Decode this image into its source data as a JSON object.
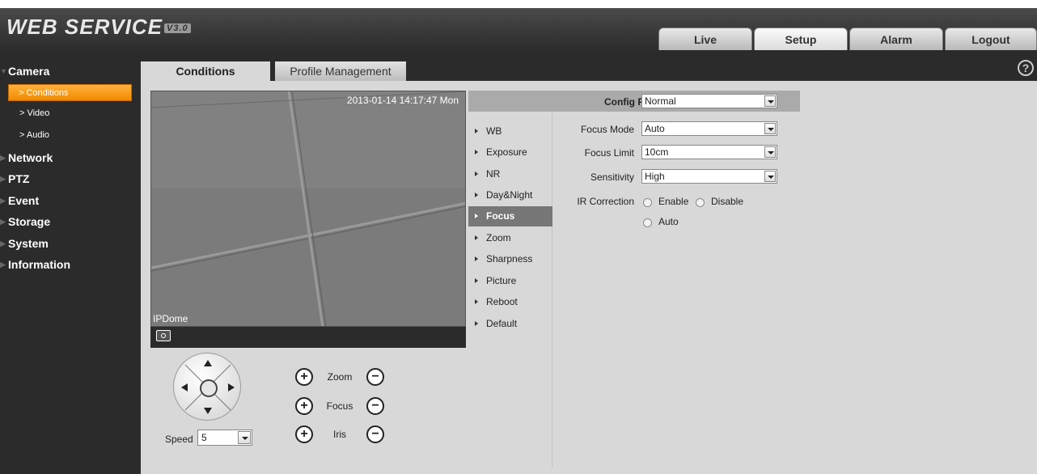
{
  "header": {
    "logo": "WEB  SERVICE",
    "version": "V3.0",
    "tabs": [
      {
        "label": "Live"
      },
      {
        "label": "Setup"
      },
      {
        "label": "Alarm"
      },
      {
        "label": "Logout"
      }
    ],
    "active_tab": "Setup"
  },
  "sidebar": {
    "camera": "Camera",
    "sub": {
      "conditions": "> Conditions",
      "video": "> Video",
      "audio": "> Audio"
    },
    "network": "Network",
    "ptz": "PTZ",
    "event": "Event",
    "storage": "Storage",
    "system": "System",
    "information": "Information"
  },
  "tabs": {
    "conditions": "Conditions",
    "profile": "Profile Management",
    "help_icon": "?"
  },
  "video": {
    "timestamp": "2013-01-14 14:17:47 Mon",
    "camera_name": "IPDome"
  },
  "ptz": {
    "speed_label": "Speed",
    "speed_value": "5",
    "zoom_label": "Zoom",
    "focus_label": "Focus",
    "iris_label": "Iris",
    "plus": "+",
    "minus": "−"
  },
  "config": {
    "config_file_label": "Config File",
    "config_file_value": "Normal",
    "menu": {
      "wb": "WB",
      "exposure": "Exposure",
      "nr": "NR",
      "daynight": "Day&Night",
      "focus": "Focus",
      "zoom": "Zoom",
      "sharpness": "Sharpness",
      "picture": "Picture",
      "reboot": "Reboot",
      "default": "Default"
    },
    "focus_mode_label": "Focus Mode",
    "focus_mode_value": "Auto",
    "focus_limit_label": "Focus Limit",
    "focus_limit_value": "10cm",
    "sensitivity_label": "Sensitivity",
    "sensitivity_value": "High",
    "ir_label": "IR Correction",
    "ir_enable": "Enable",
    "ir_disable": "Disable",
    "ir_auto": "Auto"
  },
  "colors": {
    "accent": "#f59300",
    "dark_bg": "#2b2b2b",
    "panel_bg": "#d8d8d8"
  }
}
